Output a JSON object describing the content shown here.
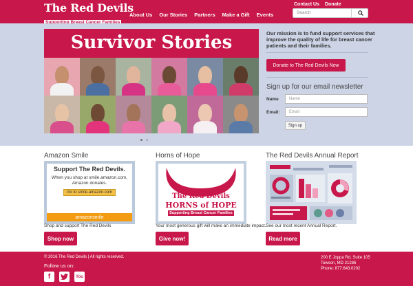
{
  "header": {
    "logo_title": "The Red Devils",
    "logo_tagline": "Supporting Breast Cancer Families",
    "nav": [
      "About Us",
      "Our Stories",
      "Partners",
      "Make a Gift",
      "Events"
    ],
    "top_links": [
      "Contact Us",
      "Donate"
    ],
    "search_placeholder": "Search"
  },
  "hero": {
    "slide_title": "Survivor Stories",
    "mission": "Our mission is to fund support services that improve the quality of life for breast cancer patients and their families.",
    "donate_button": "Donate to The Red Devils Now",
    "newsletter_title": "Sign up for our email newsletter",
    "name_label": "Name",
    "name_placeholder": "Name",
    "email_label": "Email:",
    "email_placeholder": "Email",
    "signup_button": "Sign up"
  },
  "columns": [
    {
      "title": "Amazon Smile",
      "thumb": {
        "heading": "Support The Red Devils.",
        "body": "When you shop at smile.amazon.com, Amazon donates.",
        "button": "Go to smile.amazon.com",
        "brand": "amazonsmile"
      },
      "text": "Shop and support The Red Devils",
      "button": "Shop now"
    },
    {
      "title": "Horns of Hope",
      "thumb": {
        "line1": "The Red Devils",
        "line2": "HORNS of HOPE",
        "line3": "Supporting Breast Cancer Families"
      },
      "text": "Your most generous gift will make an immediate impact.",
      "button": "Give now!"
    },
    {
      "title": "The Red Devils Annual Report",
      "text": "See our most recent Annual Report.",
      "button": "Read more"
    }
  ],
  "footer": {
    "copyright": "© 2016 The Red Devils | All rights reserved.",
    "follow": "Follow us on:",
    "address": [
      "200 E Joppa Rd, Suite 105",
      "Towson, MD 21286",
      "Phone: 877.643.0202"
    ]
  },
  "colors": {
    "brand": "#c8174a",
    "band": "#ccd4e6"
  }
}
